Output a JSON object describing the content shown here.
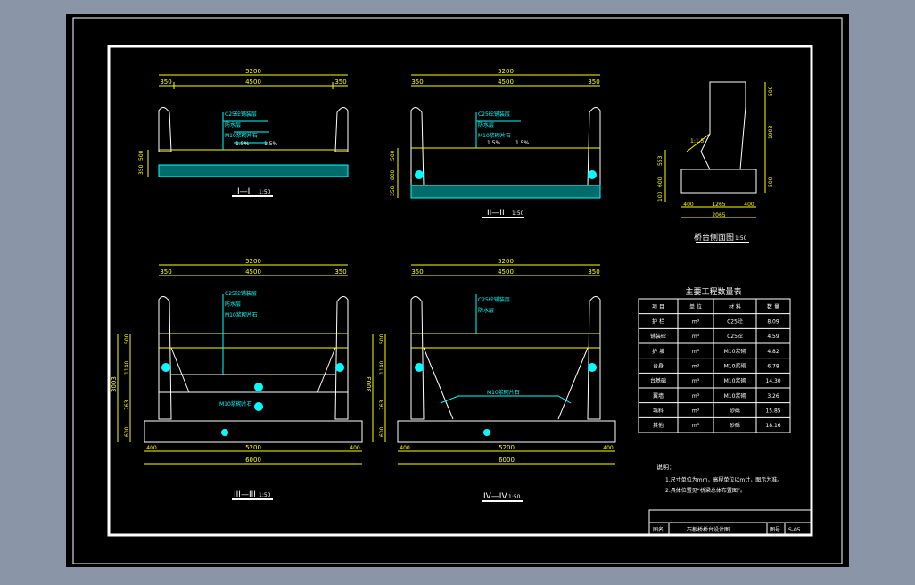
{
  "colors": {
    "background": "#8a95a8",
    "paper": "#000000",
    "frame": "#ffffff",
    "dim": "#ffff00",
    "struct": "#ffffff",
    "accent": "#00ffff",
    "green": "#00ff00"
  },
  "sections": {
    "s1": {
      "total": "5200",
      "middle": "4500",
      "left": "350",
      "right": "350",
      "title": "I—I",
      "scale": "1:50",
      "dims_v": [
        "500",
        "350"
      ],
      "notes": [
        "C25砼铺装层",
        "防水层",
        "M10浆砌片石"
      ],
      "slope1": "1.5%",
      "slope2": "1.5%"
    },
    "s2": {
      "total": "5200",
      "middle": "4500",
      "left": "350",
      "right": "350",
      "title": "II—II",
      "scale": "1:50",
      "dims_v": [
        "500",
        "800",
        "350"
      ],
      "notes": [
        "C25砼铺装层",
        "防水层",
        "M10浆砌片石"
      ],
      "slope1": "1.5%",
      "slope2": "1.5%"
    },
    "s3": {
      "total": "5200",
      "middle": "4500",
      "left": "350",
      "right": "350",
      "title": "III—III",
      "scale": "1:50",
      "bottom": "5200",
      "base": "6000",
      "b_left": "400",
      "b_right": "400",
      "dims_v": [
        "500",
        "1140",
        "763",
        "600"
      ],
      "dim_total": "3003",
      "notes": [
        "C25砼铺装层",
        "防水层",
        "M10浆砌片石"
      ],
      "fill_label": "M10浆砌片石"
    },
    "s4": {
      "total": "5200",
      "middle": "4500",
      "left": "350",
      "right": "350",
      "title": "IV—IV",
      "scale": "1:50",
      "bottom": "5200",
      "base": "6000",
      "b_left": "400",
      "b_right": "400",
      "dims_v": [
        "500",
        "1140",
        "763",
        "600"
      ],
      "dim_total": "3003",
      "notes": [
        "C25砼铺装层",
        "防水层"
      ],
      "fill_label": "M10浆砌片石"
    }
  },
  "abutment": {
    "title": "桥台侧面图",
    "scale": "1:50",
    "dims": [
      "500",
      "1903",
      "500",
      "553",
      "600",
      "100"
    ],
    "bottom": [
      "400",
      "1265",
      "400"
    ],
    "total": "2065",
    "slope": "1:1.5"
  },
  "table": {
    "title": "主要工程数量表",
    "headers": [
      "项 目",
      "单 位",
      "材 料",
      "数 量"
    ],
    "rows": [
      [
        "护 栏",
        "m³",
        "C25砼",
        "8.09"
      ],
      [
        "铺装砼",
        "m³",
        "C25砼",
        "4.59"
      ],
      [
        "护 坡",
        "m³",
        "M10浆砌",
        "4.82"
      ],
      [
        "台身",
        "m³",
        "M10浆砌",
        "6.78"
      ],
      [
        "台基础",
        "m³",
        "M10浆砌",
        "14.30"
      ],
      [
        "翼墙",
        "m³",
        "M10浆砌",
        "3.26"
      ],
      [
        "填料",
        "m³",
        "砂砾",
        "15.85"
      ],
      [
        "其他",
        "m³",
        "砂砾",
        "18.16"
      ]
    ]
  },
  "notes": {
    "title": "说明：",
    "lines": [
      "1.尺寸单位为mm，高程单位以m计，图示为准。",
      "2.具体位置见“桥梁总体布置图”。"
    ]
  },
  "titleblock": {
    "label": "图名",
    "name": "石板桥桥台设计图",
    "no_label": "图号",
    "no": "S-05"
  }
}
